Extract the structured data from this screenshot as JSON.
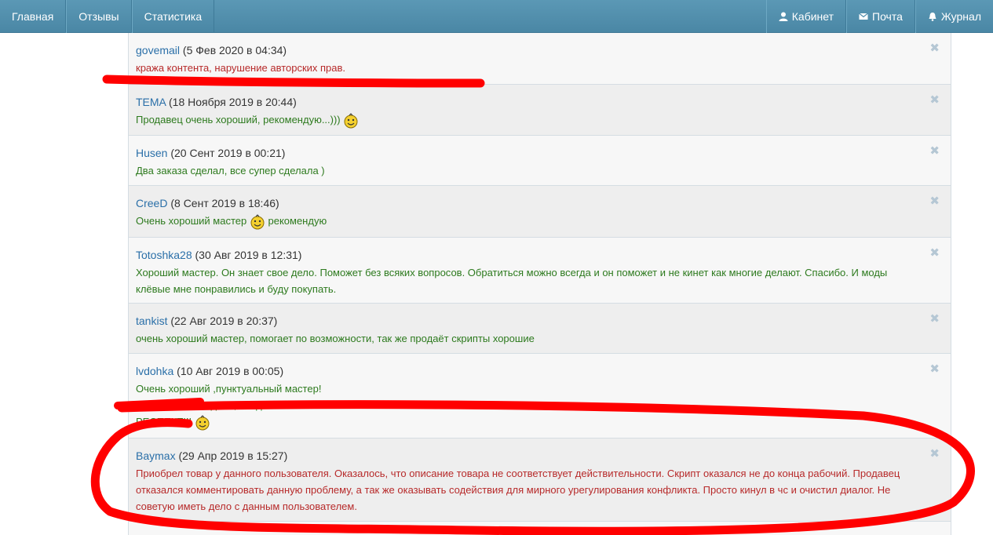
{
  "nav": {
    "left": [
      {
        "label": "Главная"
      },
      {
        "label": "Отзывы"
      },
      {
        "label": "Статистика"
      }
    ],
    "right": [
      {
        "label": "Кабинет",
        "icon": "user-icon"
      },
      {
        "label": "Почта",
        "icon": "envelope-icon"
      },
      {
        "label": "Журнал",
        "icon": "bell-icon"
      }
    ]
  },
  "reviews": [
    {
      "author": "govemail",
      "date": "(5 Фев 2020 в 04:34)",
      "lines": [
        "кража контента, нарушение авторских прав."
      ],
      "tone": "bad"
    },
    {
      "author": "TEMA",
      "date": "(18 Ноября 2019 в 20:44)",
      "lines": [
        "Продавец очень хороший, рекомендую...)))"
      ],
      "tone": "good"
    },
    {
      "author": "Husen",
      "date": "(20 Сент 2019 в 00:21)",
      "lines": [
        "Два заказа сделал, все супер сделала )"
      ],
      "tone": "good"
    },
    {
      "author": "CreeD",
      "date": "(8 Сент 2019 в 18:46)",
      "lines": [
        "Очень хороший мастер",
        "рекомендую"
      ],
      "tone": "good"
    },
    {
      "author": "Totoshka28",
      "date": "(30 Авг 2019 в 12:31)",
      "lines": [
        "Хороший мастер. Он знает свое дело. Поможет без всяких вопросов. Обратиться можно всегда и он поможет и не кинет как многие делают. Спасибо. И моды клёвые мне понравились и буду покупать."
      ],
      "tone": "good"
    },
    {
      "author": "tankist",
      "date": "(22 Авг 2019 в 20:37)",
      "lines": [
        "очень хороший мастер, помогает по возможности, так же продаёт скрипты хорошие"
      ],
      "tone": "good"
    },
    {
      "author": "lvdohka",
      "date": "(10 Авг 2019 в 00:05)",
      "lines": [
        "Очень хороший ,пунктуальный мастер!",
        "Советую иметь дело,всегда во всём поможет!",
        "РЕСПЕКТ!!!"
      ],
      "tone": "good"
    },
    {
      "author": "Baymax",
      "date": "(29 Апр 2019 в 15:27)",
      "lines": [
        "Приобрел товар у данного пользователя. Оказалось, что описание товара не соответствует действительности. Скрипт оказался не до конца рабочий. Продавец отказался комментировать данную проблему, а так же оказывать содействия для мирного урегулирования конфликта. Просто кинул в чс и очистил диалог. Не советую иметь дело с данным пользователем."
      ],
      "tone": "bad"
    }
  ],
  "close_glyph": "✖",
  "colors": {
    "navbar": "#4f8dac",
    "author_link": "#2a6fa8",
    "positive_text": "#2d7a1e",
    "negative_text": "#b72a2a",
    "annotation_marker": "#ff0000"
  }
}
